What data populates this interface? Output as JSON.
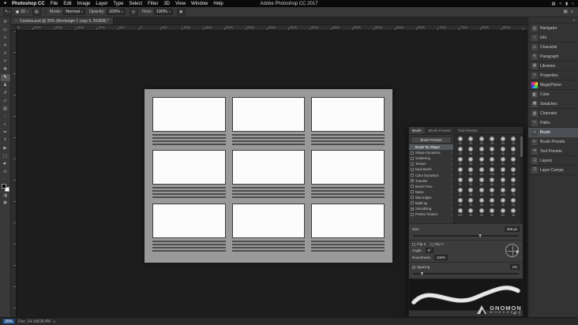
{
  "icons": {
    "apple": "●",
    "caret": "▾",
    "panel_menu": "≡",
    "collapse": "«",
    "chevron": "▸",
    "lock": "▪",
    "close": "×",
    "toggle_panel": "▤",
    "airbrush": "◉",
    "pressure": "◎",
    "workspace": "▦",
    "new_brush": "✚",
    "delete_brush": "▯"
  },
  "menubar": {
    "menus": [
      "Photoshop CC",
      "File",
      "Edit",
      "Image",
      "Layer",
      "Type",
      "Select",
      "Filter",
      "3D",
      "View",
      "Window",
      "Help"
    ],
    "window_title": "Adobe Photoshop CC 2017",
    "status_icons": [
      {
        "name": "display-icon",
        "glyph": "▤"
      },
      {
        "name": "wifi-icon",
        "glyph": "≈"
      },
      {
        "name": "battery-icon",
        "glyph": "▮"
      },
      {
        "name": "spotlight-icon",
        "glyph": "○"
      }
    ]
  },
  "options_bar": {
    "tool_icon": "✎",
    "brush_preview_size": "30",
    "mode_label": "Mode:",
    "mode_value": "Normal",
    "opacity_label": "Opacity:",
    "opacity_value": "100%",
    "flow_label": "Flow:",
    "flow_value": "100%"
  },
  "document_tab": {
    "title": "Cantina.psd @ 25% (Rectangle 1 copy 5, RGB/8) *"
  },
  "ruler": {
    "h_labels": [
      "3000",
      "2500",
      "2000",
      "1500",
      "1000",
      "500",
      "0",
      "500",
      "1000",
      "1500",
      "2000",
      "2500",
      "3000",
      "3500",
      "4000",
      "4500",
      "5000",
      "5500",
      "6000",
      "6500",
      "7000",
      "7500",
      "8000",
      "8500"
    ]
  },
  "tools": [
    {
      "name": "move-tool",
      "glyph": "✛"
    },
    {
      "name": "rectangular-marquee-tool",
      "glyph": "▭"
    },
    {
      "name": "lasso-tool",
      "glyph": "∿"
    },
    {
      "name": "quick-selection-tool",
      "glyph": "✶"
    },
    {
      "name": "crop-tool",
      "glyph": "#"
    },
    {
      "name": "eyedropper-tool",
      "glyph": "✐"
    },
    {
      "name": "spot-healing-brush-tool",
      "glyph": "✚"
    },
    {
      "name": "brush-tool",
      "glyph": "✎",
      "selected": true
    },
    {
      "name": "clone-stamp-tool",
      "glyph": "♟"
    },
    {
      "name": "history-brush-tool",
      "glyph": "↺"
    },
    {
      "name": "eraser-tool",
      "glyph": "▱"
    },
    {
      "name": "gradient-tool",
      "glyph": "▧"
    },
    {
      "name": "blur-tool",
      "glyph": "◌"
    },
    {
      "name": "dodge-tool",
      "glyph": "◐"
    },
    {
      "name": "pen-tool",
      "glyph": "✒"
    },
    {
      "name": "type-tool",
      "glyph": "T"
    },
    {
      "name": "path-selection-tool",
      "glyph": "▶"
    },
    {
      "name": "rectangle-tool",
      "glyph": "▢"
    },
    {
      "name": "hand-tool",
      "glyph": "☛"
    },
    {
      "name": "zoom-tool",
      "glyph": "⊙"
    }
  ],
  "toolbar_extras": {
    "ellipsis": "…",
    "quick_mask": "◨",
    "screen_mode": "▣"
  },
  "brush_panel": {
    "tabs": [
      {
        "label": "Brush",
        "active": true
      },
      {
        "label": "Brush Presets"
      },
      {
        "label": "Tool Presets"
      }
    ],
    "presets_button": "Brush Presets",
    "settings": [
      {
        "label": "Brush Tip Shape",
        "selected": true,
        "nocb": true
      },
      {
        "label": "Shape Dynamics"
      },
      {
        "label": "Scattering"
      },
      {
        "label": "Texture"
      },
      {
        "label": "Dual Brush"
      },
      {
        "label": "Color Dynamics"
      },
      {
        "label": "Transfer",
        "checked": true,
        "check_glyph": "✓"
      },
      {
        "label": "Brush Pose"
      },
      {
        "label": "Noise"
      },
      {
        "label": "Wet Edges"
      },
      {
        "label": "Build-up"
      },
      {
        "label": "Smoothing",
        "checked": true,
        "check_glyph": "✓"
      },
      {
        "label": "Protect Texture"
      }
    ],
    "brush_sizes": [
      30,
      30,
      30,
      25,
      95,
      36,
      25,
      36,
      36,
      36,
      36,
      32,
      25,
      50,
      25,
      25,
      50,
      71,
      25,
      95,
      29,
      192,
      36,
      36,
      36,
      33,
      63,
      66,
      39,
      63,
      11,
      48,
      32,
      55,
      100,
      75,
      45,
      15,
      26,
      48,
      32,
      45,
      197,
      30,
      20,
      36,
      50,
      36
    ],
    "size_label": "Size",
    "size_value": "500 px",
    "flip_x_label": "Flip X",
    "flip_y_label": "Flip Y",
    "angle_label": "Angle:",
    "angle_value": "0°",
    "roundness_label": "Roundness:",
    "roundness_value": "100%",
    "spacing_label": "Spacing",
    "spacing_value": "1%",
    "spacing_check": "✓"
  },
  "dock": {
    "items": [
      {
        "label": "Navigator",
        "name": "panel-navigator",
        "icon_name": "navigator-icon",
        "glyph": "◎"
      },
      {
        "label": "Info",
        "name": "panel-info",
        "icon_name": "info-icon",
        "glyph": "i",
        "group_end": true
      },
      {
        "label": "Character",
        "name": "panel-character",
        "icon_name": "character-icon",
        "glyph": "A"
      },
      {
        "label": "Paragraph",
        "name": "panel-paragraph",
        "icon_name": "paragraph-icon",
        "glyph": "¶",
        "group_end": true
      },
      {
        "label": "Libraries",
        "name": "panel-libraries",
        "icon_name": "libraries-icon",
        "glyph": "▤",
        "group_end": true
      },
      {
        "label": "Properties",
        "name": "panel-properties",
        "icon_name": "properties-icon",
        "glyph": "≡",
        "group_end": true
      },
      {
        "label": "MagicPicker",
        "name": "panel-magicpicker",
        "icon_name": "magicpicker-icon",
        "glyph": "◉",
        "rainbow": true,
        "group_end": true
      },
      {
        "label": "Color",
        "name": "panel-color",
        "icon_name": "color-icon",
        "glyph": "◧"
      },
      {
        "label": "Swatches",
        "name": "panel-swatches",
        "icon_name": "swatches-icon",
        "glyph": "▦",
        "group_end": true
      },
      {
        "label": "Channels",
        "name": "panel-channels",
        "icon_name": "channels-icon",
        "glyph": "▥"
      },
      {
        "label": "Paths",
        "name": "panel-paths",
        "icon_name": "paths-icon",
        "glyph": "∿",
        "group_end": true
      },
      {
        "label": "Brush",
        "name": "panel-brush",
        "icon_name": "brush-icon",
        "glyph": "✎",
        "selected": true
      },
      {
        "label": "Brush Presets",
        "name": "panel-brush-presets",
        "icon_name": "brush-presets-icon",
        "glyph": "✏"
      },
      {
        "label": "Tool Presets",
        "name": "panel-tool-presets",
        "icon_name": "tool-presets-icon",
        "glyph": "✛",
        "group_end": true
      },
      {
        "label": "Layers",
        "name": "panel-layers",
        "icon_name": "layers-icon",
        "glyph": "❏",
        "group_end": true
      },
      {
        "label": "Layer Comps",
        "name": "panel-layer-comps",
        "icon_name": "layer-comps-icon",
        "glyph": "❐",
        "group_end": true
      }
    ]
  },
  "status_bar": {
    "zoom": "25%",
    "doc_info": "Doc: 24.1M/28.4M"
  },
  "watermark": {
    "line1": "GNOMON",
    "line2": "WORKSHOP"
  }
}
